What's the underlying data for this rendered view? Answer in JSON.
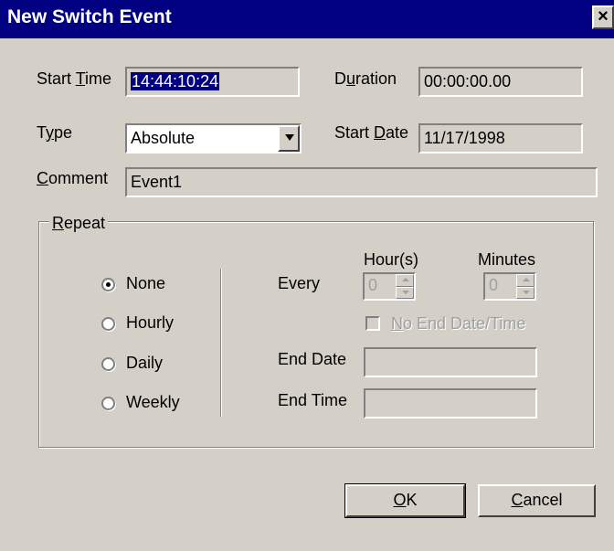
{
  "window": {
    "title": "New Switch Event",
    "close_glyph": "×"
  },
  "form": {
    "start_time": {
      "label_pre": "Start ",
      "label_u": "T",
      "label_post": "ime",
      "value": "14:44:10:24"
    },
    "duration": {
      "label_pre": "D",
      "label_u": "u",
      "label_post": "ration",
      "value": "00:00:00.00"
    },
    "type": {
      "label_pre": "T",
      "label_u": "y",
      "label_post": "pe",
      "value": "Absolute"
    },
    "start_date": {
      "label_pre": "Start ",
      "label_u": "D",
      "label_post": "ate",
      "value": "11/17/1998"
    },
    "comment": {
      "label_pre": "",
      "label_u": "C",
      "label_post": "omment",
      "value": "Event1"
    }
  },
  "repeat": {
    "group_label_u": "R",
    "group_label_post": "epeat",
    "options": [
      "None",
      "Hourly",
      "Daily",
      "Weekly"
    ],
    "selected": "None",
    "every_label": "Every",
    "hours_label": "Hour(s)",
    "hours_value": "0",
    "minutes_label": "Minutes",
    "minutes_value": "0",
    "no_end_label_u": "N",
    "no_end_label_post": "o End Date/Time",
    "end_date_label": "End Date",
    "end_date_value": "",
    "end_time_label": "End Time",
    "end_time_value": ""
  },
  "buttons": {
    "ok_u": "O",
    "ok_post": "K",
    "cancel_u": "C",
    "cancel_post": "ancel"
  },
  "colors": {
    "titlebar": "#000080",
    "face": "#d4d0c8",
    "selection": "#000080"
  }
}
